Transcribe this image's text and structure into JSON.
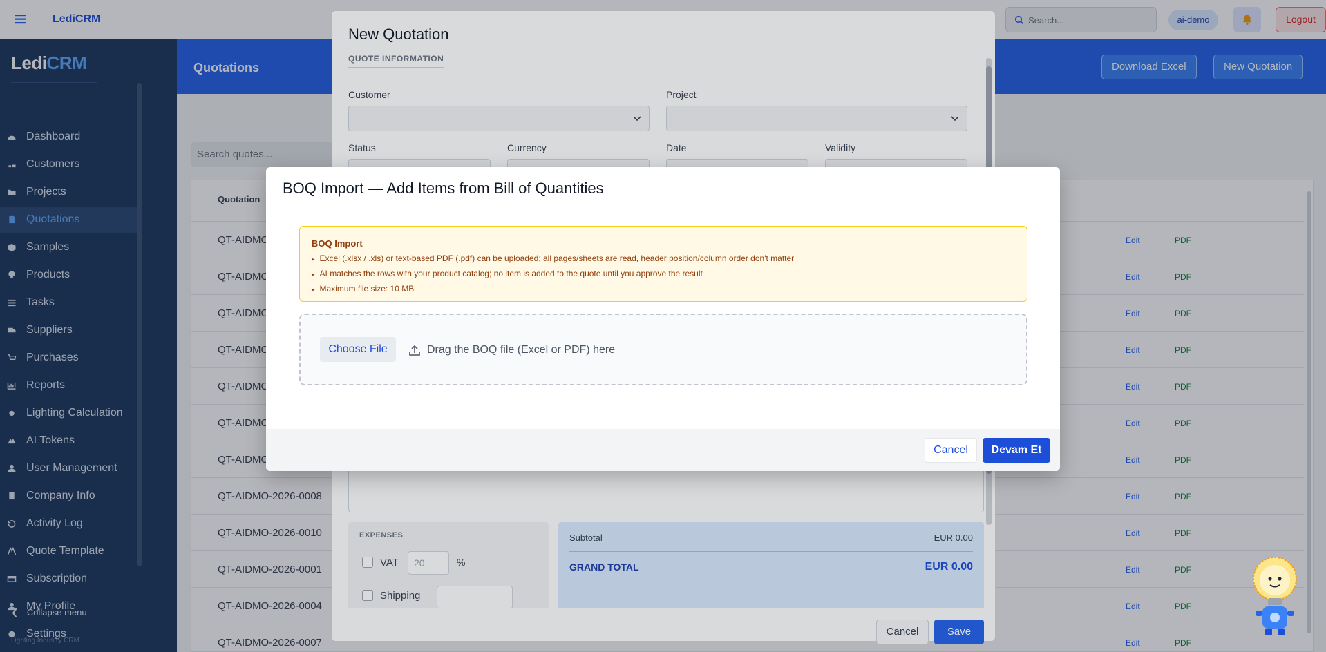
{
  "app": {
    "brand": "LediCRM",
    "logo_prefix": "Ledi",
    "logo_suffix": "CRM"
  },
  "topbar": {
    "search_placeholder": "Search...",
    "user": "ai-demo",
    "logout": "Logout"
  },
  "sidebar": {
    "items": [
      {
        "label": "Dashboard",
        "icon": "gauge-icon",
        "active": false
      },
      {
        "label": "Customers",
        "icon": "users-icon",
        "active": false
      },
      {
        "label": "Projects",
        "icon": "folder-icon",
        "active": false
      },
      {
        "label": "Quotations",
        "icon": "document-icon",
        "active": true
      },
      {
        "label": "Samples",
        "icon": "box-icon",
        "active": false
      },
      {
        "label": "Products",
        "icon": "lightbulb-icon",
        "active": false
      },
      {
        "label": "Tasks",
        "icon": "list-icon",
        "active": false
      },
      {
        "label": "Suppliers",
        "icon": "truck-icon",
        "active": false
      },
      {
        "label": "Purchases",
        "icon": "cart-icon",
        "active": false
      },
      {
        "label": "Reports",
        "icon": "chart-icon",
        "active": false
      },
      {
        "label": "Lighting Calculation",
        "icon": "sun-icon",
        "active": false
      },
      {
        "label": "AI Tokens",
        "icon": "token-icon",
        "active": false
      },
      {
        "label": "User Management",
        "icon": "user-icon",
        "active": false
      },
      {
        "label": "Company Info",
        "icon": "building-icon",
        "active": false
      },
      {
        "label": "Activity Log",
        "icon": "history-icon",
        "active": false
      },
      {
        "label": "Quote Template",
        "icon": "template-icon",
        "active": false
      },
      {
        "label": "Subscription",
        "icon": "card-icon",
        "active": false
      },
      {
        "label": "My Profile",
        "icon": "profile-icon",
        "active": false
      },
      {
        "label": "Settings",
        "icon": "gear-icon",
        "active": false
      }
    ],
    "collapse": "Collapse menu",
    "footer": "Lighting Industry CRM"
  },
  "page": {
    "title": "Quotations",
    "download_excel": "Download Excel",
    "new_quotation": "New Quotation",
    "search_placeholder": "Search quotes...",
    "column_quotation": "Quotation",
    "rows": [
      {
        "id": "QT-AIDMO",
        "edit": "Edit",
        "pdf": "PDF"
      },
      {
        "id": "QT-AIDMO",
        "edit": "Edit",
        "pdf": "PDF"
      },
      {
        "id": "QT-AIDMO",
        "edit": "Edit",
        "pdf": "PDF"
      },
      {
        "id": "QT-AIDMO",
        "edit": "Edit",
        "pdf": "PDF"
      },
      {
        "id": "QT-AIDMO",
        "edit": "Edit",
        "pdf": "PDF"
      },
      {
        "id": "QT-AIDMO",
        "edit": "Edit",
        "pdf": "PDF"
      },
      {
        "id": "QT-AIDMO",
        "edit": "Edit",
        "pdf": "PDF"
      },
      {
        "id": "QT-AIDMO-2026-0008",
        "edit": "Edit",
        "pdf": "PDF"
      },
      {
        "id": "QT-AIDMO-2026-0010",
        "edit": "Edit",
        "pdf": "PDF"
      },
      {
        "id": "QT-AIDMO-2026-0001",
        "edit": "Edit",
        "pdf": "PDF"
      },
      {
        "id": "QT-AIDMO-2026-0004",
        "edit": "Edit",
        "pdf": "PDF"
      },
      {
        "id": "QT-AIDMO-2026-0007",
        "edit": "Edit",
        "pdf": "PDF"
      }
    ]
  },
  "new_quote_modal": {
    "title": "New Quotation",
    "section": "QUOTE INFORMATION",
    "customer_label": "Customer",
    "project_label": "Project",
    "status_label": "Status",
    "currency_label": "Currency",
    "date_label": "Date",
    "validity_label": "Validity",
    "expenses_title": "EXPENSES",
    "vat_label": "VAT",
    "vat_value": "20",
    "vat_unit": "%",
    "shipping_label": "Shipping",
    "subtotal_label": "Subtotal",
    "subtotal_value": "EUR 0.00",
    "grand_total_label": "GRAND TOTAL",
    "grand_total_value": "EUR 0.00",
    "cancel": "Cancel",
    "save": "Save"
  },
  "boq_modal": {
    "title": "BOQ Import — Add Items from Bill of Quantities",
    "info_title": "BOQ Import",
    "bullets": [
      "Excel (.xlsx / .xls) or text-based PDF (.pdf) can be uploaded; all pages/sheets are read, header position/column order don't matter",
      "AI matches the rows with your product catalog; no item is added to the quote until you approve the result",
      "Maximum file size: 10 MB"
    ],
    "choose_file": "Choose File",
    "drop_text": "Drag the BOQ file (Excel or PDF) here",
    "cancel": "Cancel",
    "continue": "Devam Et"
  },
  "colors": {
    "primary": "#2563eb",
    "sidebar_bg": "#1e3a5f",
    "warning_bg": "#fff9e6",
    "warning_border": "#facc15"
  }
}
